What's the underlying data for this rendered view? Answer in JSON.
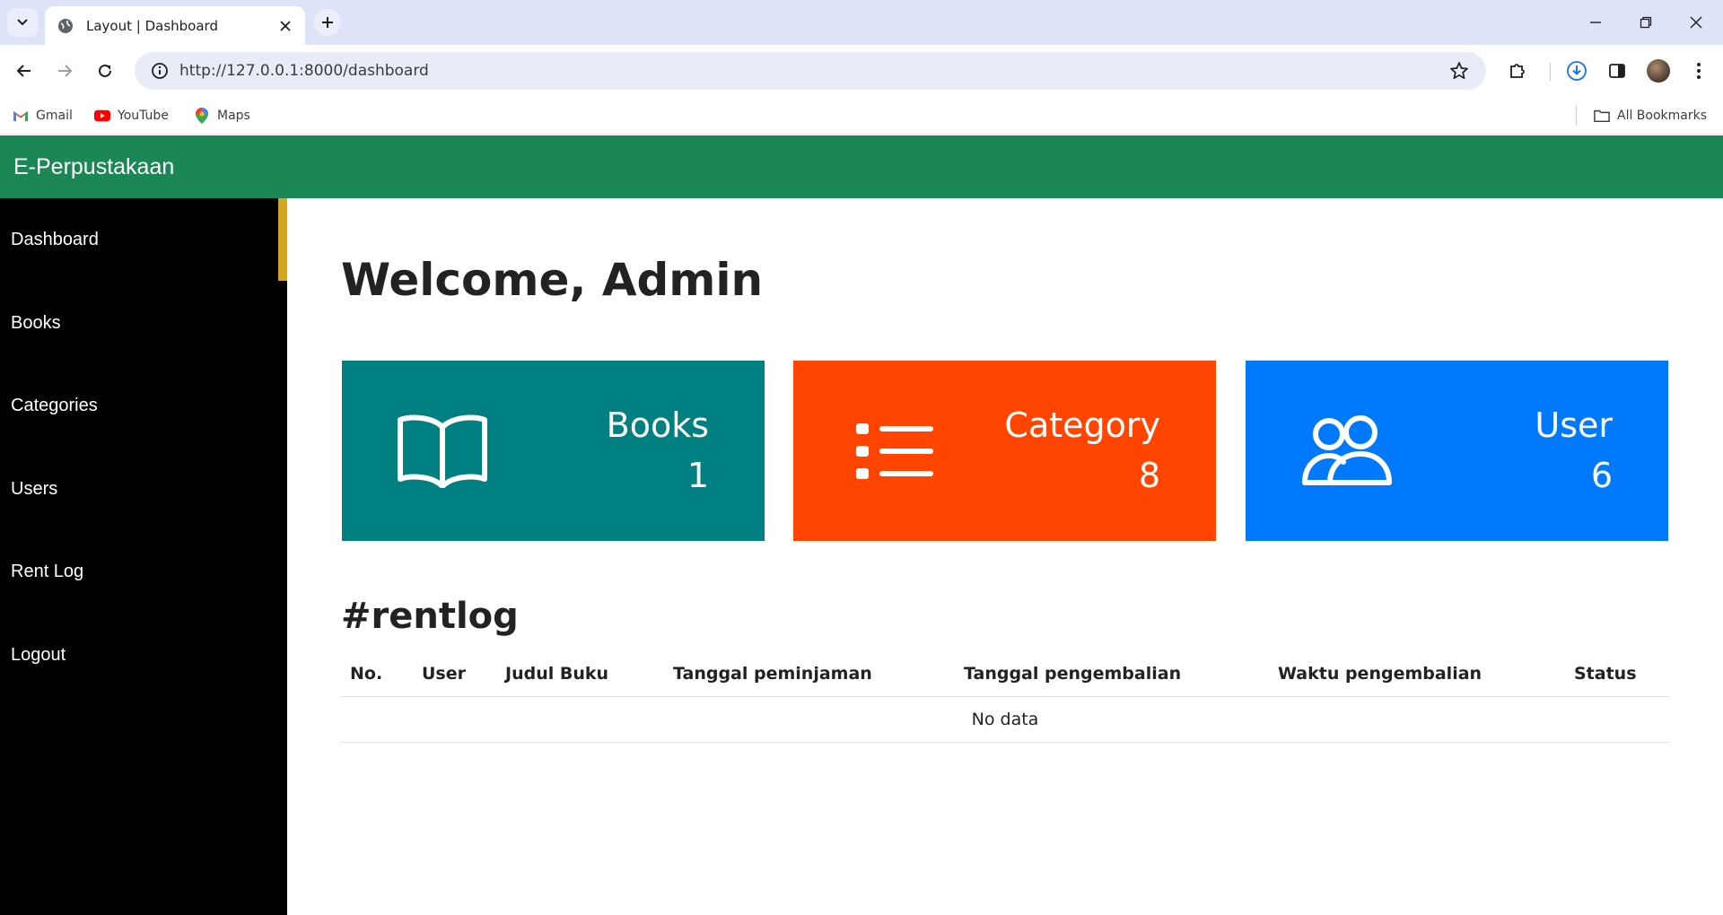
{
  "browser": {
    "tab_title": "Layout | Dashboard",
    "url": "http://127.0.0.1:8000/dashboard",
    "bookmarks": [
      {
        "label": "Gmail",
        "icon": "gmail-icon"
      },
      {
        "label": "YouTube",
        "icon": "youtube-icon"
      },
      {
        "label": "Maps",
        "icon": "maps-icon"
      }
    ],
    "all_bookmarks_label": "All Bookmarks"
  },
  "header": {
    "brand": "E-Perpustakaan",
    "color": "#1b8754"
  },
  "sidebar": {
    "items": [
      {
        "label": "Dashboard",
        "active": true
      },
      {
        "label": "Books"
      },
      {
        "label": "Categories"
      },
      {
        "label": "Users"
      },
      {
        "label": "Rent Log"
      },
      {
        "label": "Logout"
      }
    ],
    "active_indicator_color": "#d4a623"
  },
  "main": {
    "welcome": "Welcome, Admin",
    "cards": [
      {
        "label": "Books",
        "value": "1",
        "icon": "book-icon",
        "color": "#008080"
      },
      {
        "label": "Category",
        "value": "8",
        "icon": "list-icon",
        "color": "#ff4500"
      },
      {
        "label": "User",
        "value": "6",
        "icon": "users-icon",
        "color": "#0079fb"
      }
    ],
    "rentlog": {
      "title": "#rentlog",
      "columns": [
        "No.",
        "User",
        "Judul Buku",
        "Tanggal peminjaman",
        "Tanggal pengembalian",
        "Waktu pengembalian",
        "Status"
      ],
      "empty_text": "No data"
    }
  }
}
